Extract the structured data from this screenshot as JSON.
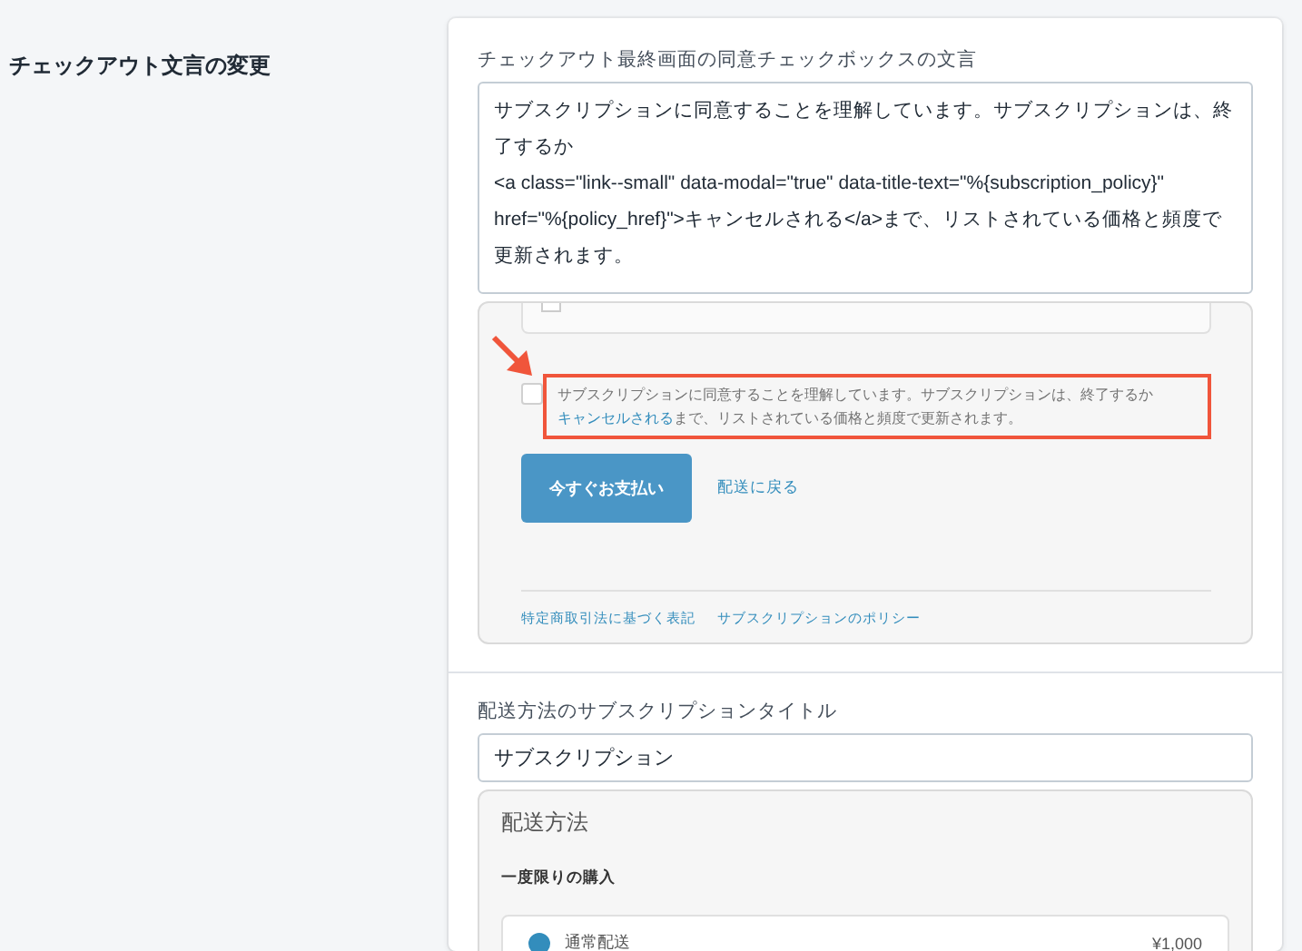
{
  "section": {
    "title": "チェックアウト文言の変更"
  },
  "agreement_field": {
    "label": "チェックアウト最終画面の同意チェックボックスの文言",
    "value": "サブスクリプションに同意することを理解しています。サブスクリプションは、終了するか\n<a class=\"link--small\" data-modal=\"true\" data-title-text=\"%{subscription_policy}\" href=\"%{policy_href}\">キャンセルされる</a>まで、リストされている価格と頻度で更新されます。"
  },
  "checkout_preview": {
    "partial_option": {
      "checked": false
    },
    "checkbox": {
      "checked": false,
      "highlighted": true,
      "text_before": "サブスクリプションに同意することを理解しています。サブスクリプションは、終了するか",
      "link": "キャンセルされる",
      "text_after": "まで、リストされている価格と頻度で更新されます。"
    },
    "pay_button": "今すぐお支払い",
    "back_link": "配送に戻る",
    "footer_links": [
      "特定商取引法に基づく表記",
      "サブスクリプションのポリシー"
    ]
  },
  "shipping_title_field": {
    "label": "配送方法のサブスクリプションタイトル",
    "value": "サブスクリプション"
  },
  "shipping_preview": {
    "heading": "配送方法",
    "subheading": "一度限りの購入",
    "options": [
      {
        "name": "通常配送",
        "price": "¥1,000",
        "selected": true
      }
    ]
  }
}
